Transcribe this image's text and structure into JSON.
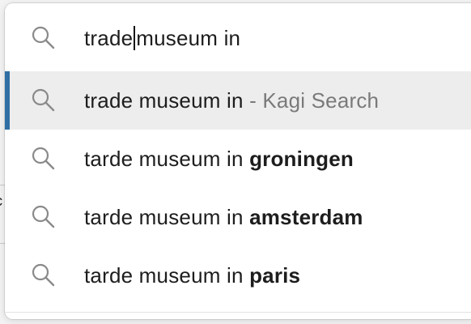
{
  "search": {
    "query_before_caret": "trade",
    "query_after_caret": "museum in",
    "icon": "search-icon"
  },
  "suggestions": [
    {
      "prefix": "trade museum in",
      "bold": "",
      "provider": " - Kagi Search",
      "selected": true,
      "icon": "search-icon"
    },
    {
      "prefix": "tarde museum in ",
      "bold": "groningen",
      "provider": "",
      "selected": false,
      "icon": "search-icon"
    },
    {
      "prefix": "tarde museum in ",
      "bold": "amsterdam",
      "provider": "",
      "selected": false,
      "icon": "search-icon"
    },
    {
      "prefix": "tarde museum in ",
      "bold": "paris",
      "provider": "",
      "selected": false,
      "icon": "search-icon"
    }
  ],
  "colors": {
    "selected_bar": "#2f6fa3",
    "selected_row_bg": "#ededed",
    "icon_stroke": "#8a8a8a",
    "provider_text": "#7a7a7a"
  }
}
